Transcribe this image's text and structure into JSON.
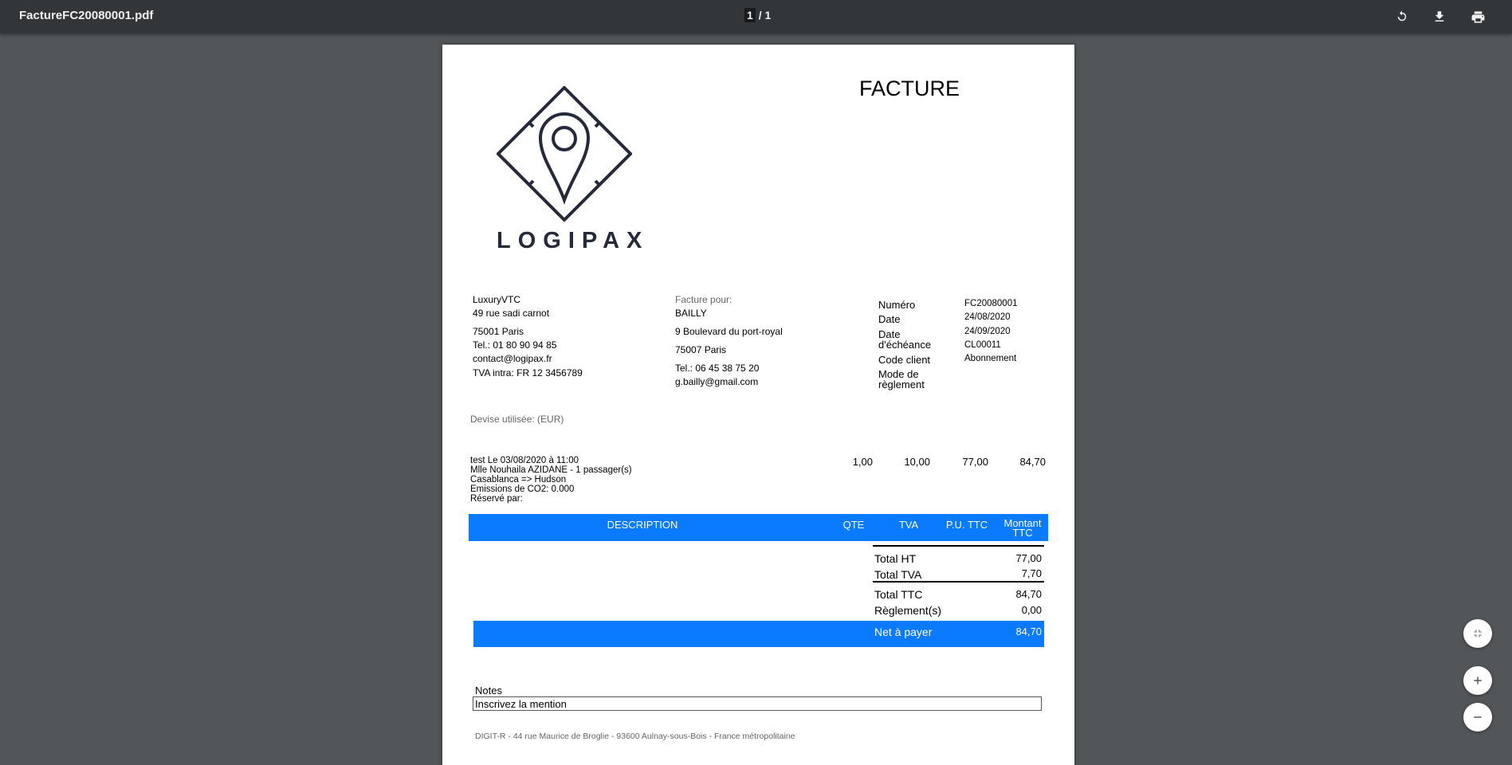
{
  "viewer": {
    "filename": "FactureFC20080001.pdf",
    "page_current": "1",
    "page_sep": "/",
    "page_total": "1",
    "icons": [
      "rotate-icon",
      "download-icon",
      "print-icon",
      "fit-page-icon",
      "zoom-in-icon",
      "zoom-out-icon"
    ]
  },
  "invoice": {
    "title": "FACTURE",
    "logo_text": "LOGIPAX",
    "seller": {
      "name": "LuxuryVTC",
      "street": "49 rue sadi carnot",
      "city": "75001 Paris",
      "tel": "Tel.: 01 80 90 94 85",
      "email": "contact@logipax.fr",
      "vat": "TVA intra: FR 12 3456789"
    },
    "client": {
      "heading": "Facture pour:",
      "name": "BAILLY",
      "street": "9 Boulevard du port-royal",
      "city": "75007 Paris",
      "tel": "Tel.: 06 45 38 75 20",
      "email": "g.bailly@gmail.com"
    },
    "meta": {
      "numero_label": "Numéro",
      "numero_value": "FC20080001",
      "date_label": "Date",
      "date_value": "24/08/2020",
      "echeance_label": "Date d'échéance",
      "echeance_value": "24/09/2020",
      "code_label": "Code client",
      "code_value": "CL00011",
      "mode_label": "Mode de règlement",
      "mode_value": "Abonnement"
    },
    "currency": "Devise utilisée: (EUR)",
    "line": {
      "desc1": "test Le 03/08/2020 à 11:00",
      "desc2": "Mlle Nouhaila AZIDANE - 1 passager(s)",
      "desc3": "Casablanca => Hudson",
      "desc4": "Emissions de CO2: 0.000",
      "desc5": "Réservé par:",
      "qte": "1,00",
      "tva": "10,00",
      "pu": "77,00",
      "montant": "84,70"
    },
    "table_headers": {
      "description": "DESCRIPTION",
      "qte": "QTE",
      "tva": "TVA",
      "pu": "P.U. TTC",
      "montant": "Montant TTC"
    },
    "totals": {
      "ht_label": "Total HT",
      "ht_value": "77,00",
      "tva_label": "Total TVA",
      "tva_value": "7,70",
      "ttc_label": "Total TTC",
      "ttc_value": "84,70",
      "reglements_label": "Règlement(s)",
      "reglements_value": "0,00",
      "net_label": "Net à payer",
      "net_value": "84,70"
    },
    "notes_label": "Notes",
    "notes_value": "Inscrivez la mention",
    "footer": "DIGIT-R - 44 rue Maurice de Broglie - 93600 Aulnay-sous-Bois - France métropolitaine"
  }
}
